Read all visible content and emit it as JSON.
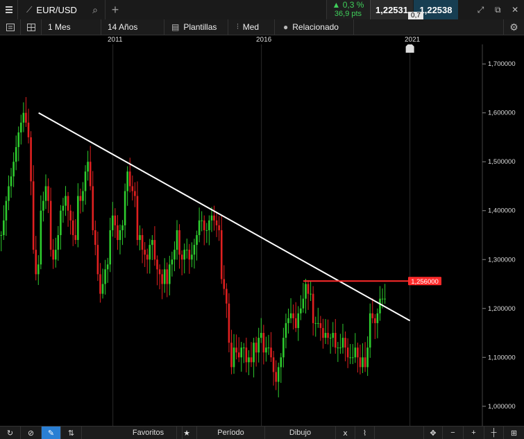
{
  "header": {
    "symbol": "EUR/USD",
    "change_pct": "▲ 0,3 %",
    "change_pts": "36,9 pts",
    "bid": "1,22531",
    "ask": "1,22538",
    "spread": "0,7"
  },
  "toolbar": {
    "interval": "1 Mes",
    "range": "14 Años",
    "templates": "Plantillas",
    "price_type": "Med",
    "related": "Relacionado"
  },
  "bottom": {
    "favorites": "Favoritos",
    "period": "Período",
    "drawing": "Dibujo"
  },
  "colors": {
    "up": "#2ecc2e",
    "down": "#e02020",
    "trendline": "#ffffff",
    "level": "#ff2a2a",
    "ask_bg": "#173e52"
  },
  "chart_data": {
    "type": "candlestick",
    "x_ticks": [
      "2011",
      "2016",
      "2021"
    ],
    "y_ticks": [
      "1,700000",
      "1,600000",
      "1,500000",
      "1,400000",
      "1,300000",
      "1,200000",
      "1,100000",
      "1,000000"
    ],
    "y_tick_values": [
      1.7,
      1.6,
      1.5,
      1.4,
      1.3,
      1.2,
      1.1,
      1.0
    ],
    "ylim": [
      0.96,
      1.74
    ],
    "level_label": "1,256000",
    "level_value": 1.256,
    "trendline": {
      "from": [
        "2008-07",
        1.6
      ],
      "to": [
        "2021-01",
        1.175
      ]
    },
    "monthly_closes": [
      1.35,
      1.38,
      1.42,
      1.45,
      1.47,
      1.5,
      1.53,
      1.56,
      1.58,
      1.6,
      1.58,
      1.55,
      1.46,
      1.32,
      1.27,
      1.29,
      1.4,
      1.42,
      1.45,
      1.42,
      1.32,
      1.3,
      1.32,
      1.35,
      1.4,
      1.41,
      1.43,
      1.4,
      1.38,
      1.35,
      1.34,
      1.43,
      1.42,
      1.44,
      1.48,
      1.5,
      1.45,
      1.36,
      1.33,
      1.27,
      1.23,
      1.25,
      1.28,
      1.29,
      1.36,
      1.39,
      1.37,
      1.34,
      1.36,
      1.37,
      1.44,
      1.48,
      1.45,
      1.44,
      1.43,
      1.34,
      1.35,
      1.32,
      1.31,
      1.3,
      1.33,
      1.34,
      1.3,
      1.28,
      1.27,
      1.25,
      1.28,
      1.25,
      1.29,
      1.3,
      1.32,
      1.36,
      1.31,
      1.3,
      1.32,
      1.32,
      1.3,
      1.31,
      1.33,
      1.35,
      1.38,
      1.38,
      1.36,
      1.36,
      1.38,
      1.39,
      1.38,
      1.37,
      1.36,
      1.26,
      1.24,
      1.21,
      1.13,
      1.08,
      1.12,
      1.11,
      1.1,
      1.12,
      1.12,
      1.09,
      1.1,
      1.09,
      1.13,
      1.11,
      1.14,
      1.15,
      1.11,
      1.12,
      1.12,
      1.1,
      1.07,
      1.05,
      1.08,
      1.1,
      1.14,
      1.17,
      1.18,
      1.19,
      1.18,
      1.16,
      1.19,
      1.2,
      1.22,
      1.25,
      1.23,
      1.23,
      1.17,
      1.17,
      1.17,
      1.16,
      1.14,
      1.15,
      1.14,
      1.14,
      1.15,
      1.12,
      1.12,
      1.12,
      1.14,
      1.12,
      1.1,
      1.1,
      1.1,
      1.12,
      1.1,
      1.08,
      1.1,
      1.08,
      1.12,
      1.19,
      1.18,
      1.17,
      1.19,
      1.22,
      1.22,
      1.22
    ]
  }
}
